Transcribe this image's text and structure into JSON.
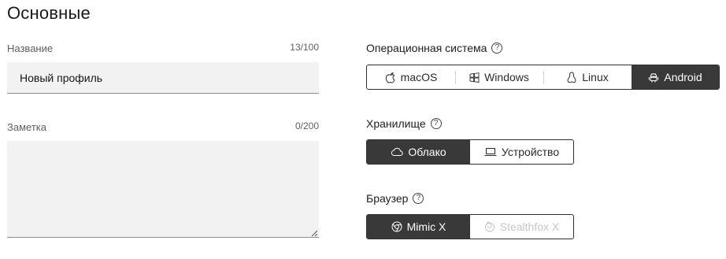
{
  "section": {
    "title": "Основные"
  },
  "name_field": {
    "label": "Название",
    "counter": "13/100",
    "value": "Новый профиль"
  },
  "note_field": {
    "label": "Заметка",
    "counter": "0/200",
    "value": ""
  },
  "os": {
    "label": "Операционная система",
    "help": "?",
    "options": [
      {
        "label": "macOS",
        "icon": "apple-icon",
        "selected": false
      },
      {
        "label": "Windows",
        "icon": "windows-icon",
        "selected": false
      },
      {
        "label": "Linux",
        "icon": "linux-icon",
        "selected": false
      },
      {
        "label": "Android",
        "icon": "android-icon",
        "selected": true
      }
    ]
  },
  "storage": {
    "label": "Хранилище",
    "help": "?",
    "options": [
      {
        "label": "Облако",
        "icon": "cloud-icon",
        "selected": true
      },
      {
        "label": "Устройство",
        "icon": "laptop-icon",
        "selected": false
      }
    ]
  },
  "browser": {
    "label": "Браузер",
    "help": "?",
    "options": [
      {
        "label": "Mimic X",
        "icon": "chrome-icon",
        "selected": true
      },
      {
        "label": "Stealthfox X",
        "icon": "firefox-icon",
        "selected": false,
        "disabled": true
      }
    ]
  },
  "colors": {
    "active_bg": "#393939",
    "input_bg": "#f2f2f2",
    "border": "#2f2f2f"
  }
}
